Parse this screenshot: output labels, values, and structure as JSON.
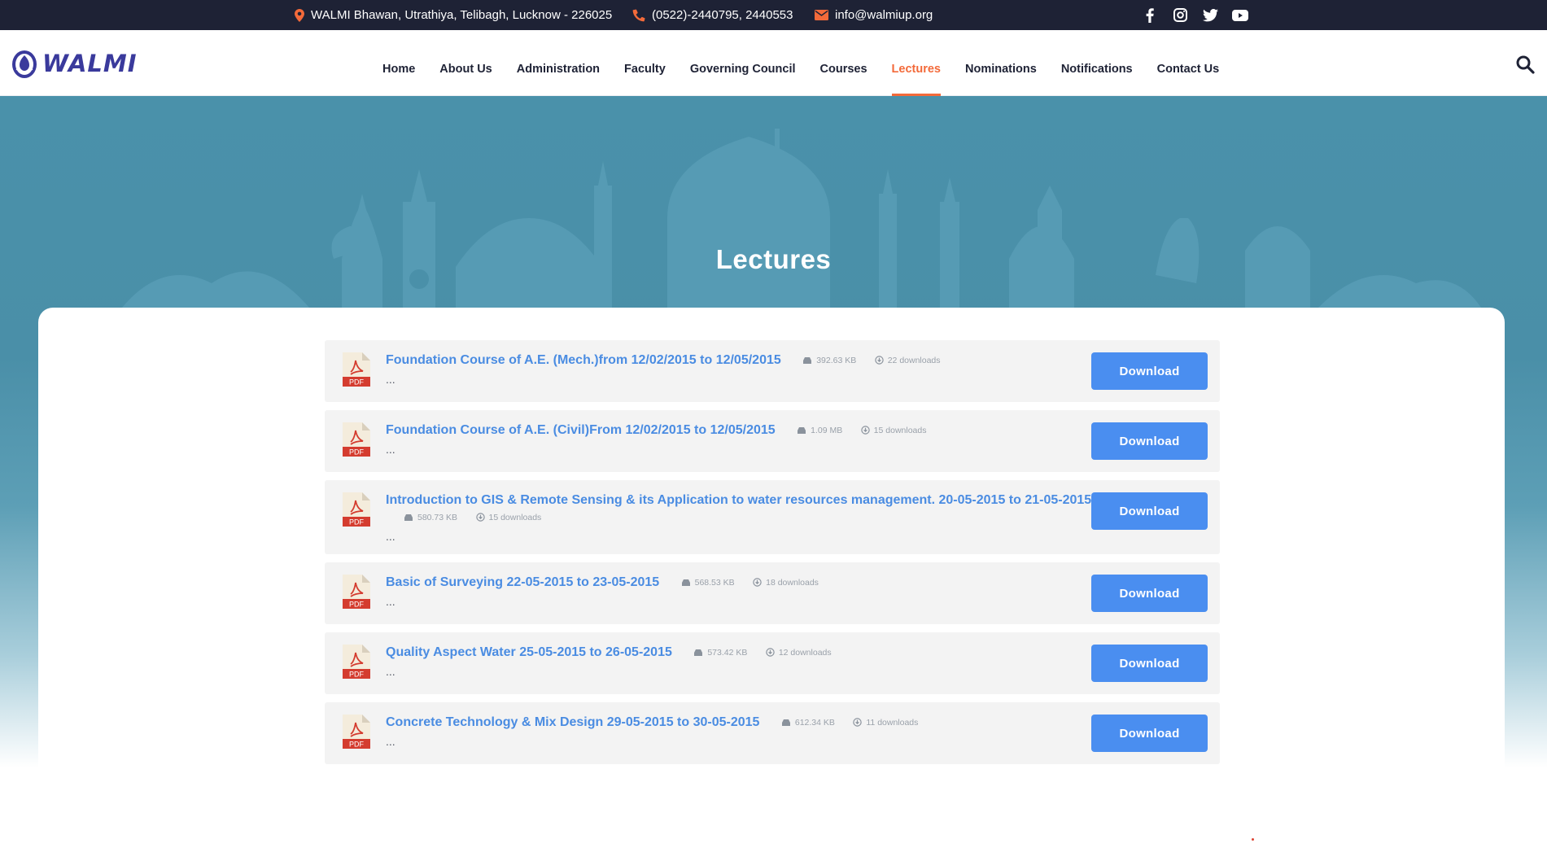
{
  "topbar": {
    "address": "WALMI Bhawan, Utrathiya, Telibagh, Lucknow - 226025",
    "phone": "(0522)-2440795, 2440553",
    "email": "info@walmiup.org",
    "social_icons": [
      "facebook-icon",
      "instagram-icon",
      "twitter-icon",
      "youtube-icon"
    ]
  },
  "header": {
    "logo_text": "WALMI",
    "nav": [
      {
        "label": "Home"
      },
      {
        "label": "About Us"
      },
      {
        "label": "Administration"
      },
      {
        "label": "Faculty"
      },
      {
        "label": "Governing Council"
      },
      {
        "label": "Courses"
      },
      {
        "label": "Lectures",
        "active": true
      },
      {
        "label": "Nominations"
      },
      {
        "label": "Notifications"
      },
      {
        "label": "Contact Us"
      }
    ]
  },
  "hero": {
    "title": "Lectures"
  },
  "colors": {
    "accent": "#f36a3a",
    "link": "#4a8ce2",
    "button": "#4a8ef0",
    "topbar": "#1e2235",
    "hero": "#4a91aa"
  },
  "lectures": [
    {
      "title": "Foundation Course of A.E. (Mech.)from 12/02/2015 to 12/05/2015",
      "size": "392.63 KB",
      "downloads": "22 downloads",
      "excerpt": "...",
      "button": "Download"
    },
    {
      "title": "Foundation Course of A.E. (Civil)From 12/02/2015 to 12/05/2015",
      "size": "1.09 MB",
      "downloads": "15 downloads",
      "excerpt": "...",
      "button": "Download"
    },
    {
      "title": "Introduction to GIS & Remote Sensing & its Application to water resources management. 20-05-2015 to 21-05-2015",
      "size": "580.73 KB",
      "downloads": "15 downloads",
      "excerpt": "...",
      "button": "Download"
    },
    {
      "title": "Basic of Surveying 22-05-2015 to 23-05-2015",
      "size": "568.53 KB",
      "downloads": "18 downloads",
      "excerpt": "...",
      "button": "Download"
    },
    {
      "title": "Quality Aspect Water 25-05-2015 to 26-05-2015",
      "size": "573.42 KB",
      "downloads": "12 downloads",
      "excerpt": "...",
      "button": "Download"
    },
    {
      "title": "Concrete Technology & Mix Design 29-05-2015 to 30-05-2015",
      "size": "612.34 KB",
      "downloads": "11 downloads",
      "excerpt": "...",
      "button": "Download"
    }
  ],
  "icons": {
    "pdf": "pdf-file-icon",
    "size": "hard-drive-icon",
    "downloads": "download-circle-icon",
    "search": "search-icon",
    "address": "map-pin-icon",
    "phone": "phone-icon",
    "email": "envelope-icon"
  }
}
